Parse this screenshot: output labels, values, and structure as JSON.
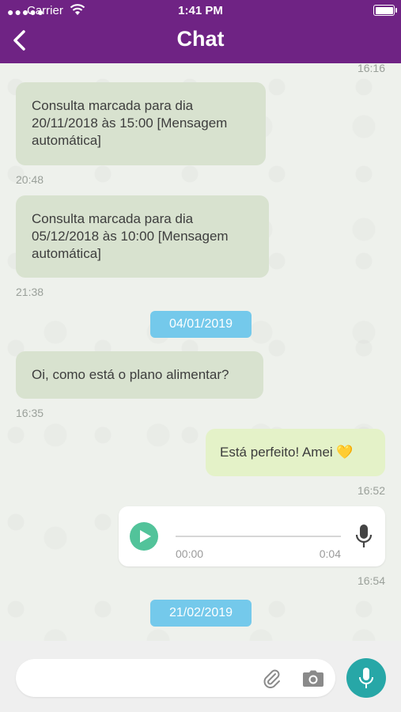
{
  "status_bar": {
    "carrier": "Carrier",
    "time": "1:41 PM"
  },
  "header": {
    "title": "Chat"
  },
  "messages": {
    "top_timestamp": "16:16",
    "m1": {
      "text": "Consulta marcada para dia 20/11/2018 às 15:00 [Mensagem automática]",
      "time": "20:48"
    },
    "m2": {
      "text": "Consulta marcada para dia 05/12/2018 às 10:00 [Mensagem automática]",
      "time": "21:38"
    },
    "date1": "04/01/2019",
    "m3": {
      "text": "Oi, como está o plano alimentar?",
      "time": "16:35"
    },
    "m4": {
      "text": "Está perfeito! Amei 💛",
      "time": "16:52"
    },
    "audio": {
      "elapsed": "00:00",
      "duration": "0:04",
      "time": "16:54",
      "progress": 0
    },
    "date2": "21/02/2019"
  },
  "input": {
    "placeholder": ""
  },
  "colors": {
    "header": "#6f2384",
    "incoming_bubble": "#d8e2cf",
    "outgoing_bubble": "#e4f2c8",
    "date_chip": "#74c9eb",
    "play": "#52c39a",
    "mic_button": "#27a7a7"
  },
  "icons": {
    "back": "chevron-left-icon",
    "attach": "paperclip-icon",
    "camera": "camera-icon",
    "mic": "microphone-icon",
    "play": "play-icon"
  }
}
